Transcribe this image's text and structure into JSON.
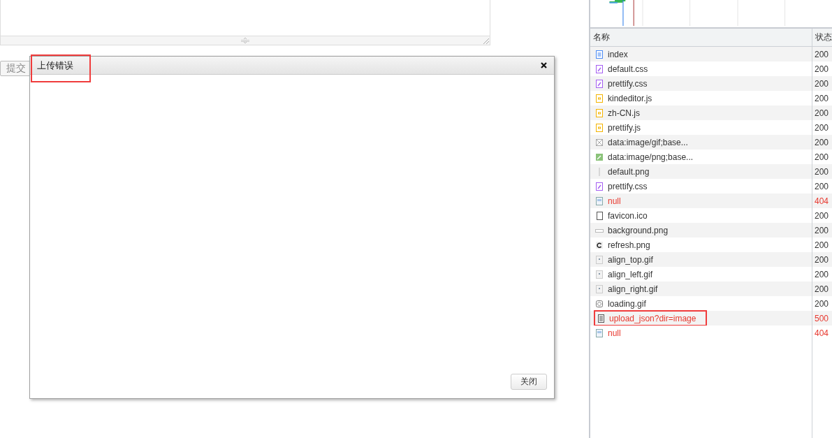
{
  "editor": {
    "submit_button": "提交"
  },
  "dialog": {
    "title": "上传错误",
    "title_annotated": true,
    "close_button": "关闭"
  },
  "network": {
    "columns": [
      "名称",
      "状态"
    ],
    "rows": [
      {
        "kind": "document",
        "name": "index",
        "status": "200",
        "failed": false,
        "annotated": false
      },
      {
        "kind": "stylesheet",
        "name": "default.css",
        "status": "200",
        "failed": false,
        "annotated": false
      },
      {
        "kind": "stylesheet",
        "name": "prettify.css",
        "status": "200",
        "failed": false,
        "annotated": false
      },
      {
        "kind": "script",
        "name": "kindeditor.js",
        "status": "200",
        "failed": false,
        "annotated": false
      },
      {
        "kind": "script",
        "name": "zh-CN.js",
        "status": "200",
        "failed": false,
        "annotated": false
      },
      {
        "kind": "script",
        "name": "prettify.js",
        "status": "200",
        "failed": false,
        "annotated": false
      },
      {
        "kind": "broken",
        "name": "data:image/gif;base...",
        "status": "200",
        "failed": false,
        "annotated": false
      },
      {
        "kind": "image",
        "name": "data:image/png;base...",
        "status": "200",
        "failed": false,
        "annotated": false
      },
      {
        "kind": "line",
        "name": "default.png",
        "status": "200",
        "failed": false,
        "annotated": false
      },
      {
        "kind": "stylesheet",
        "name": "prettify.css",
        "status": "200",
        "failed": false,
        "annotated": false
      },
      {
        "kind": "picture",
        "name": "null",
        "status": "404",
        "failed": true,
        "annotated": false
      },
      {
        "kind": "page",
        "name": "favicon.ico",
        "status": "200",
        "failed": false,
        "annotated": false
      },
      {
        "kind": "bar",
        "name": "background.png",
        "status": "200",
        "failed": false,
        "annotated": false
      },
      {
        "kind": "refresh",
        "name": "refresh.png",
        "status": "200",
        "failed": false,
        "annotated": false
      },
      {
        "kind": "thumb",
        "name": "align_top.gif",
        "status": "200",
        "failed": false,
        "annotated": false
      },
      {
        "kind": "thumb",
        "name": "align_left.gif",
        "status": "200",
        "failed": false,
        "annotated": false
      },
      {
        "kind": "thumb",
        "name": "align_right.gif",
        "status": "200",
        "failed": false,
        "annotated": false
      },
      {
        "kind": "spinner",
        "name": "loading.gif",
        "status": "200",
        "failed": false,
        "annotated": false
      },
      {
        "kind": "lines",
        "name": "upload_json?dir=image",
        "status": "500",
        "failed": true,
        "annotated": true
      },
      {
        "kind": "picture",
        "name": "null",
        "status": "404",
        "failed": true,
        "annotated": false
      }
    ]
  }
}
